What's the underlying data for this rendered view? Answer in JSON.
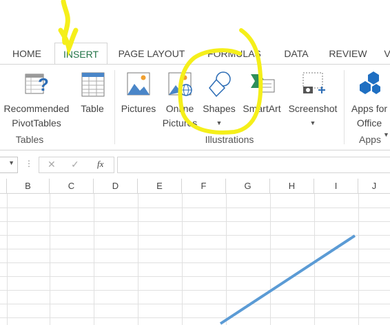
{
  "tabs": [
    "HOME",
    "INSERT",
    "PAGE LAYOUT",
    "FORMULAS",
    "DATA",
    "REVIEW",
    "V"
  ],
  "ribbon": {
    "recommended_line1": "Recommended",
    "recommended_line2": "PivotTables",
    "table": "Table",
    "tables_group": "Tables",
    "pictures": "Pictures",
    "online_line1": "Online",
    "online_line2": "Pictures",
    "shapes": "Shapes",
    "smartart": "SmartArt",
    "screenshot": "Screenshot",
    "illustrations_group": "Illustrations",
    "apps_line1": "Apps for",
    "apps_line2": "Office",
    "apps_group": "Apps"
  },
  "formula_bar": {
    "fx": "fx",
    "cancel": "✕",
    "enter": "✓",
    "value": ""
  },
  "columns": [
    "B",
    "C",
    "D",
    "E",
    "F",
    "G",
    "H",
    "I",
    "J"
  ],
  "colors": {
    "accent": "#217346",
    "highlight": "#f5ef1a",
    "line": "#5b9bd5"
  }
}
